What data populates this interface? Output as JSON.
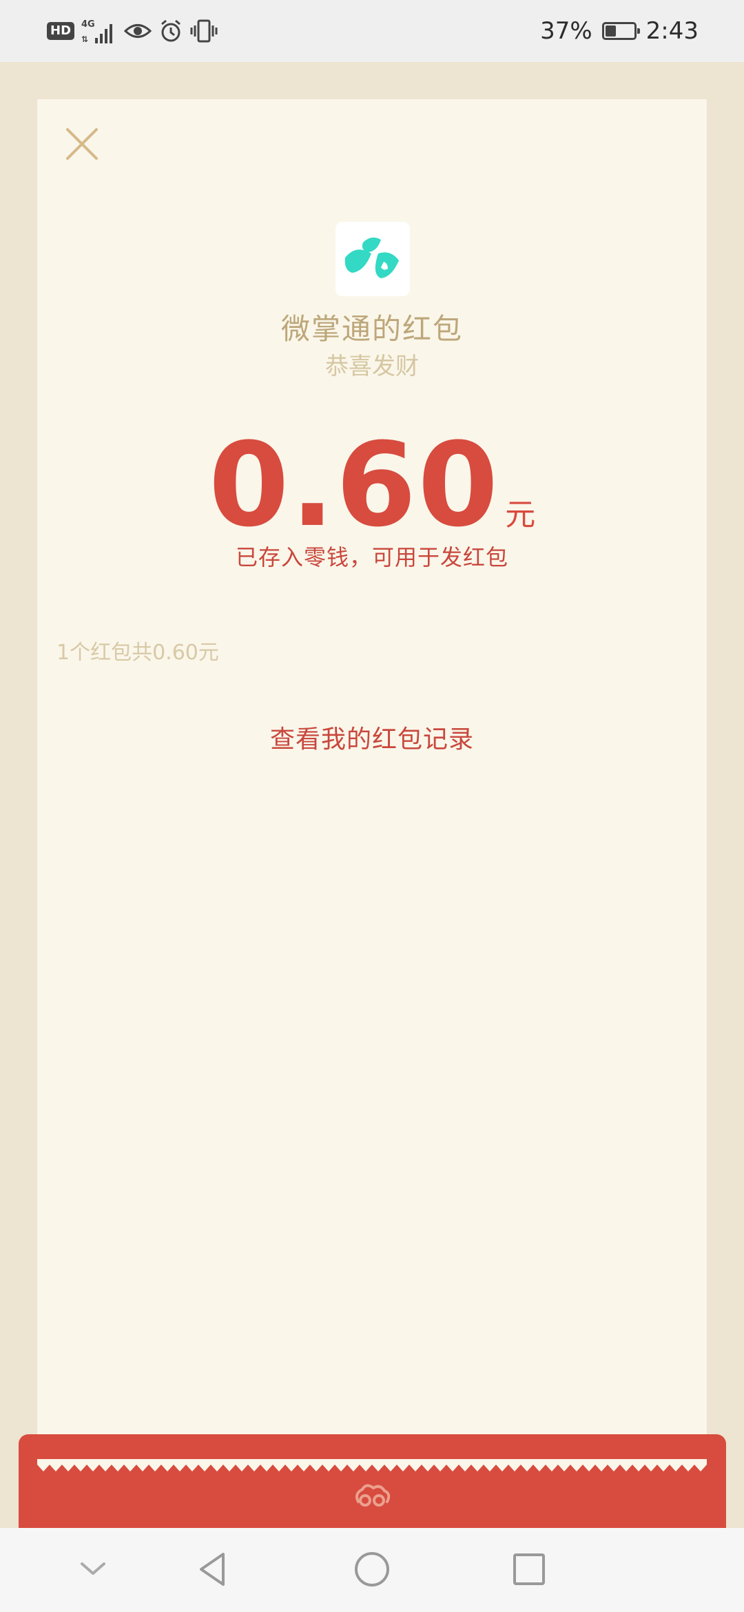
{
  "status_bar": {
    "hd": "HD",
    "network": "4G",
    "battery_percent": "37%",
    "battery_level": 0.37,
    "time": "2:43",
    "icons": [
      "hd-icon",
      "signal-4g-icon",
      "eye-icon",
      "alarm-icon",
      "vibrate-icon",
      "battery-icon"
    ]
  },
  "envelope": {
    "sender": "微掌通的红包",
    "greeting": "恭喜发财",
    "amount": "0.60",
    "unit": "元",
    "note": "已存入零钱，可用于发红包",
    "summary": "1个红包共0.60元",
    "record_link": "查看我的红包记录"
  },
  "colors": {
    "accent_red": "#d84b3f",
    "gold_text": "#bda77a",
    "card_bg": "#faf6ea",
    "logo_teal": "#33d9c4"
  },
  "nav_bar": {
    "icons": [
      "chevron-down-icon",
      "back-icon",
      "home-icon",
      "recents-icon"
    ]
  }
}
